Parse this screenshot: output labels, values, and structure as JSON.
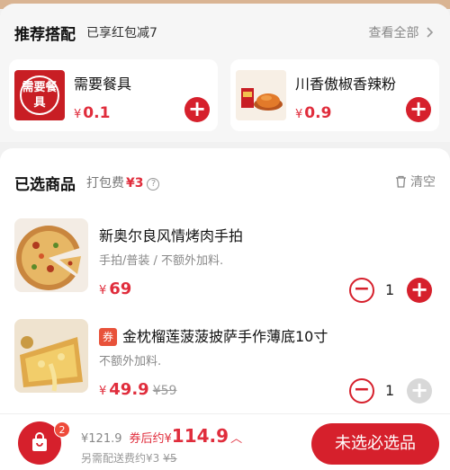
{
  "recommend": {
    "title": "推荐搭配",
    "subtitle": "已享红包减7",
    "view_all": "查看全部",
    "cards": [
      {
        "name": "需要餐具",
        "thumb_text": "需要餐具",
        "price_symbol": "¥",
        "price": "0.1",
        "icon": "tableware-icon"
      },
      {
        "name": "川香傲椒香辣粉",
        "price_symbol": "¥",
        "price": "0.9",
        "icon": "chili-powder-icon"
      }
    ]
  },
  "selected": {
    "title": "已选商品",
    "pack_label": "打包费",
    "pack_fee": "¥3",
    "clear_label": "清空",
    "items": [
      {
        "name": "新奥尔良风情烤肉手拍",
        "spec": "手拍/普装 / 不额外加料.",
        "price_symbol": "¥",
        "price": "69",
        "original_price": "",
        "quantity": "1",
        "has_coupon": false
      },
      {
        "coupon_tag": "券",
        "name": "金枕榴莲菠菠披萨手作薄底10寸",
        "spec": "不额外加料.",
        "price_symbol": "¥",
        "price": "49.9",
        "original_price": "¥59",
        "quantity": "1",
        "has_coupon": true
      }
    ]
  },
  "bottom": {
    "cart_count": "2",
    "total_before": "¥121.9",
    "after_coupon_label": "券后约",
    "final_symbol": "¥",
    "final_price": "114.9",
    "delivery_text": "另需配送费约¥3",
    "delivery_original": "¥5",
    "checkout_label": "未选必选品"
  },
  "colors": {
    "accent": "#d6202c",
    "price": "#e02d3c",
    "muted": "#888888"
  }
}
